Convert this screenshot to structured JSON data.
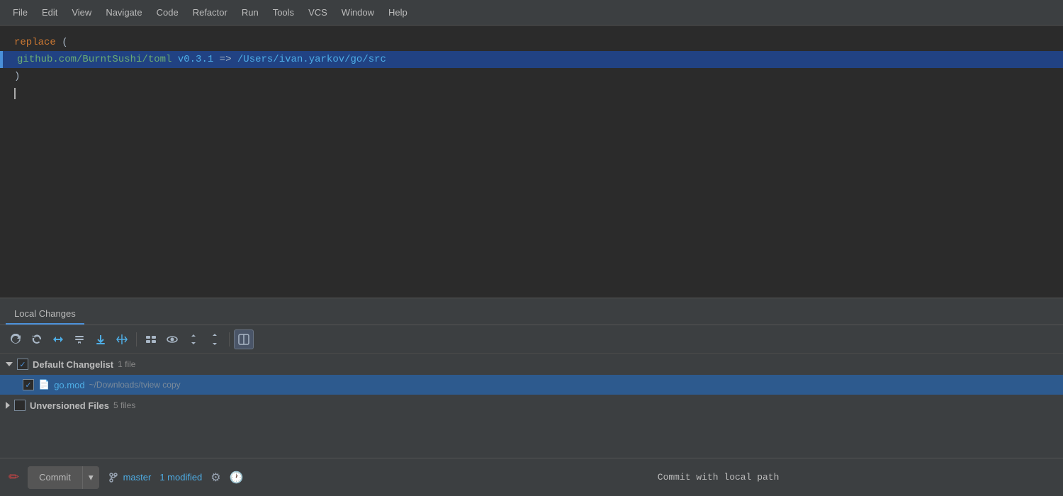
{
  "menubar": {
    "items": [
      "File",
      "Edit",
      "View",
      "Navigate",
      "Code",
      "Refactor",
      "Run",
      "Tools",
      "VCS",
      "Window",
      "Help"
    ]
  },
  "editor": {
    "lines": [
      {
        "id": 1,
        "type": "keyword",
        "content": "replace ("
      },
      {
        "id": 2,
        "type": "code",
        "content": "    github.com/BurntSushi/toml v0.3.1 => /Users/ivan.yarkov/go/src",
        "highlighted": true
      },
      {
        "id": 3,
        "type": "plain",
        "content": ")"
      },
      {
        "id": 4,
        "type": "cursor",
        "content": ""
      }
    ]
  },
  "local_changes": {
    "tab_label": "Local Changes",
    "toolbar": {
      "refresh": "↻",
      "rollback": "↺",
      "diff": "←→",
      "shelf": "⊟",
      "update": "⊻",
      "move": "✥",
      "group1": "⊞",
      "eye": "◎",
      "expand_all": "≡↓",
      "collapse_all": "≡↑",
      "layout": "▣"
    },
    "changelist": {
      "name": "Default Changelist",
      "count_label": "1 file",
      "files": [
        {
          "name": "go.mod",
          "path": "~/Downloads/tview copy",
          "checked": true
        }
      ]
    },
    "unversioned": {
      "name": "Unversioned Files",
      "count_label": "5 files"
    }
  },
  "bottom_bar": {
    "status_text": "Commit with local path",
    "commit_btn": "Commit",
    "dropdown_arrow": "▾",
    "branch_name": "master",
    "modified": "1 modified"
  }
}
